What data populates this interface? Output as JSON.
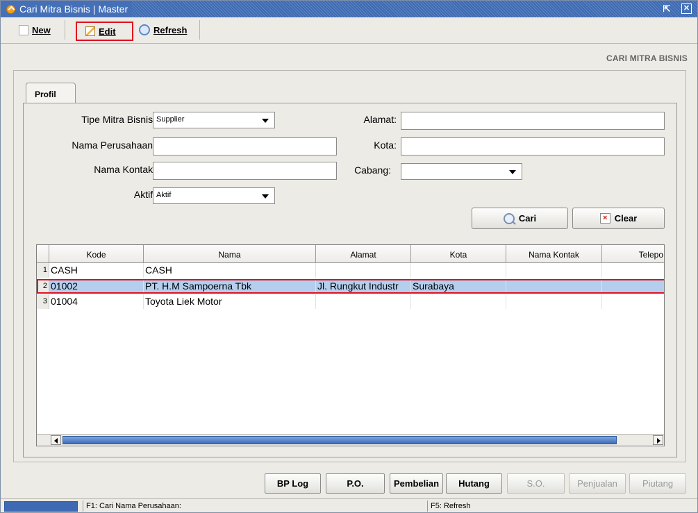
{
  "window": {
    "title": "Cari Mitra Bisnis | Master",
    "max_glyph": "⇱",
    "close_glyph": "✕"
  },
  "toolbar": {
    "new_label": "New",
    "edit_label": "Edit",
    "refresh_label": "Refresh"
  },
  "header": {
    "label": "CARI MITRA BISNIS"
  },
  "tabs": [
    {
      "label": "Profil"
    }
  ],
  "form": {
    "tipe_label": "Tipe Mitra Bisnis:",
    "tipe_value": "Supplier",
    "nama_perusahaan_label": "Nama Perusahaan:",
    "nama_kontak_label": "Nama Kontak:",
    "aktif_label": "Aktif:",
    "aktif_value": "Aktif",
    "alamat_label": "Alamat:",
    "kota_label": "Kota:",
    "cabang_label": "Cabang:",
    "cari_label": "Cari",
    "clear_label": "Clear"
  },
  "grid": {
    "columns": [
      "Kode",
      "Nama",
      "Alamat",
      "Kota",
      "Nama Kontak",
      "Telepo"
    ],
    "rows": [
      {
        "n": "1",
        "kode": "CASH",
        "nama": "CASH",
        "alamat": "",
        "kota": ""
      },
      {
        "n": "2",
        "kode": "01002",
        "nama": "PT. H.M Sampoerna Tbk",
        "alamat": "Jl. Rungkut Industr",
        "kota": "Surabaya"
      },
      {
        "n": "3",
        "kode": "01004",
        "nama": "Toyota Liek Motor",
        "alamat": "",
        "kota": ""
      }
    ],
    "selected_row": 2
  },
  "bottom_buttons": {
    "bp_log": "BP Log",
    "po": "P.O.",
    "pembelian": "Pembelian",
    "hutang": "Hutang",
    "so": "S.O.",
    "penjualan": "Penjualan",
    "piutang": "Piutang"
  },
  "status": {
    "f1": "F1: Cari Nama Perusahaan:",
    "f5": "F5: Refresh"
  }
}
